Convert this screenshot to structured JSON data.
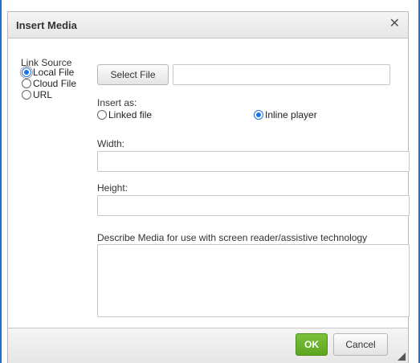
{
  "dialog": {
    "title": "Insert Media",
    "close_symbol": "✕"
  },
  "link_source": {
    "label": "Link Source",
    "options": [
      {
        "label": "Local File",
        "checked": true
      },
      {
        "label": "Cloud File",
        "checked": false
      },
      {
        "label": "URL",
        "checked": false
      }
    ]
  },
  "file": {
    "select_label": "Select File",
    "path_value": ""
  },
  "insert_as": {
    "label": "Insert as:",
    "linked_label": "Linked file",
    "inline_label": "Inline player",
    "selected": "Inline player"
  },
  "width": {
    "label": "Width:",
    "value": ""
  },
  "height": {
    "label": "Height:",
    "value": ""
  },
  "description": {
    "label": "Describe Media for use with screen reader/assistive technology",
    "value": ""
  },
  "footer": {
    "ok_label": "OK",
    "cancel_label": "Cancel"
  },
  "colors": {
    "accent_blue": "#1f6fc5",
    "ok_green": "#5ca522"
  },
  "icons": [
    "close-icon",
    "resize-grip-icon"
  ]
}
